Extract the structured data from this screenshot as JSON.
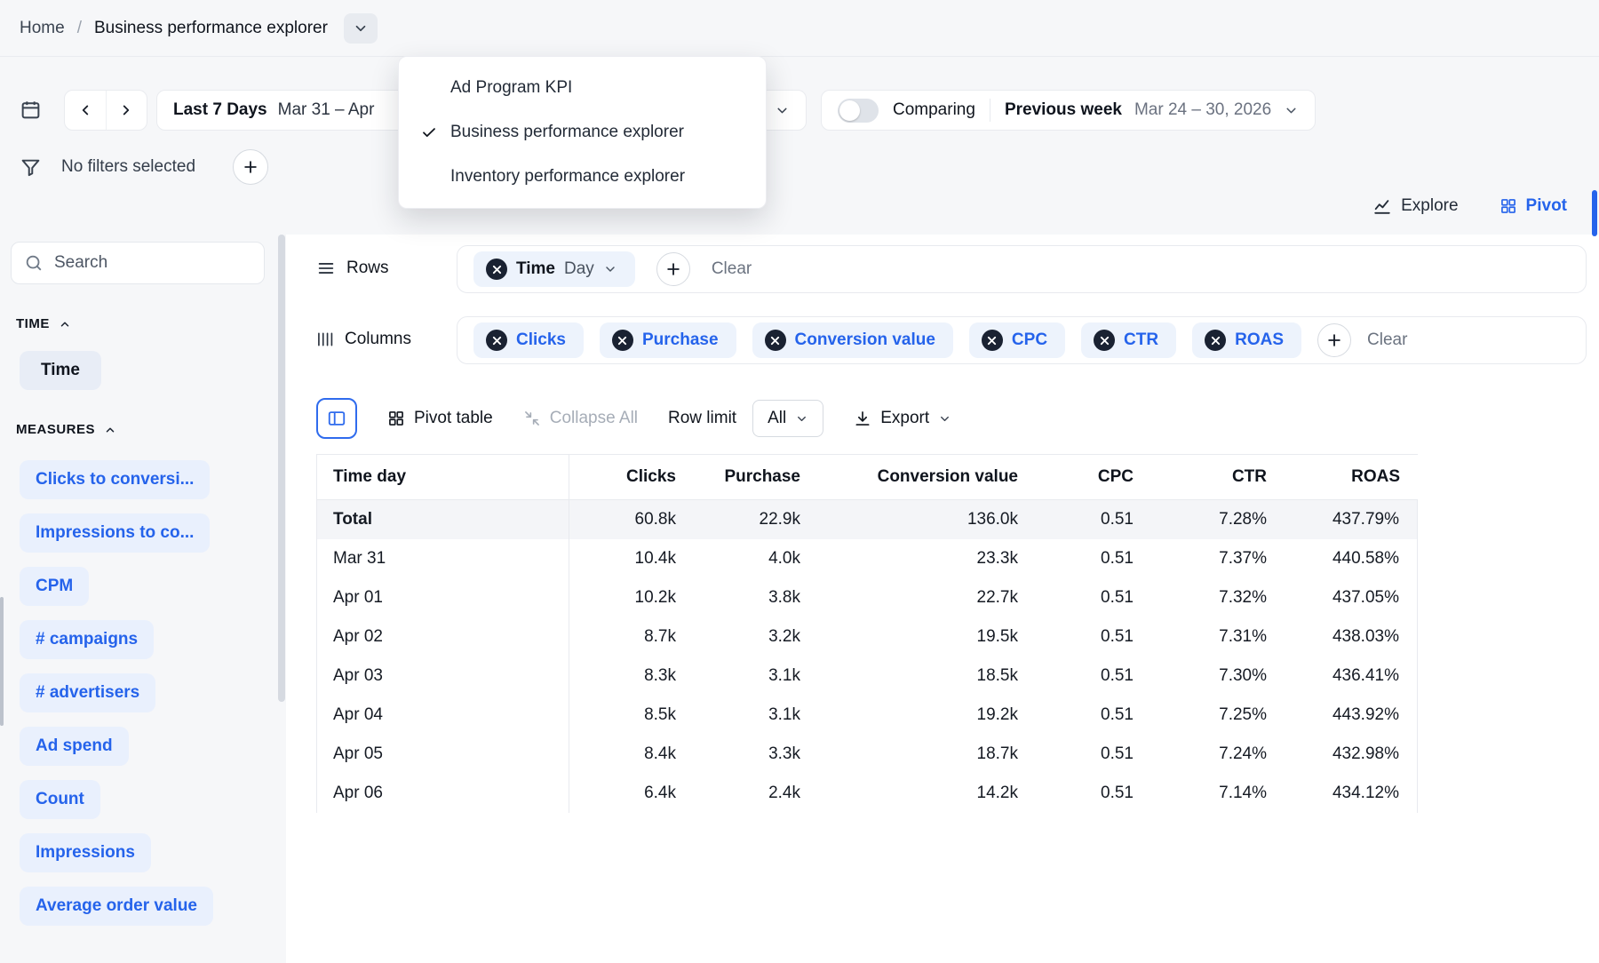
{
  "accent_color": "#2563eb",
  "breadcrumb": {
    "home": "Home",
    "separator": "/",
    "current": "Business performance explorer"
  },
  "explorer_menu": {
    "items": [
      {
        "label": "Ad Program KPI",
        "checked": false
      },
      {
        "label": "Business performance explorer",
        "checked": true
      },
      {
        "label": "Inventory performance explorer",
        "checked": false
      }
    ]
  },
  "date_controls": {
    "preset": "Last 7 Days",
    "range": "Mar 31 – Apr",
    "comparing_label": "Comparing",
    "comparing_enabled": false,
    "compare_mode": "Previous week",
    "compare_range": "Mar 24 – 30, 2026"
  },
  "filter_bar": {
    "empty_label": "No filters selected"
  },
  "view_tabs": {
    "explore": "Explore",
    "pivot": "Pivot",
    "active": "Pivot"
  },
  "sidebar": {
    "search_placeholder": "Search",
    "time_section": {
      "title": "TIME",
      "items": [
        "Time"
      ]
    },
    "measures_section": {
      "title": "MEASURES",
      "items": [
        "Clicks to conversi...",
        "Impressions to co...",
        "CPM",
        "# campaigns",
        "# advertisers",
        "Ad spend",
        "Count",
        "Impressions",
        "Average order value"
      ]
    }
  },
  "pivot_builder": {
    "rows_label": "Rows",
    "row_chip": {
      "dimension": "Time",
      "granularity": "Day"
    },
    "columns_label": "Columns",
    "column_chips": [
      "Clicks",
      "Purchase",
      "Conversion value",
      "CPC",
      "CTR",
      "ROAS"
    ],
    "clear_label": "Clear"
  },
  "table_toolbar": {
    "pivot_table": "Pivot table",
    "collapse_all": "Collapse All",
    "row_limit_label": "Row limit",
    "row_limit_value": "All",
    "export": "Export"
  },
  "table": {
    "columns": [
      "Time day",
      "Clicks",
      "Purchase",
      "Conversion value",
      "CPC",
      "CTR",
      "ROAS"
    ],
    "total": [
      "Total",
      "60.8k",
      "22.9k",
      "136.0k",
      "0.51",
      "7.28%",
      "437.79%"
    ],
    "rows": [
      [
        "Mar 31",
        "10.4k",
        "4.0k",
        "23.3k",
        "0.51",
        "7.37%",
        "440.58%"
      ],
      [
        "Apr 01",
        "10.2k",
        "3.8k",
        "22.7k",
        "0.51",
        "7.32%",
        "437.05%"
      ],
      [
        "Apr 02",
        "8.7k",
        "3.2k",
        "19.5k",
        "0.51",
        "7.31%",
        "438.03%"
      ],
      [
        "Apr 03",
        "8.3k",
        "3.1k",
        "18.5k",
        "0.51",
        "7.30%",
        "436.41%"
      ],
      [
        "Apr 04",
        "8.5k",
        "3.1k",
        "19.2k",
        "0.51",
        "7.25%",
        "443.92%"
      ],
      [
        "Apr 05",
        "8.4k",
        "3.3k",
        "18.7k",
        "0.51",
        "7.24%",
        "432.98%"
      ],
      [
        "Apr 06",
        "6.4k",
        "2.4k",
        "14.2k",
        "0.51",
        "7.14%",
        "434.12%"
      ]
    ]
  }
}
